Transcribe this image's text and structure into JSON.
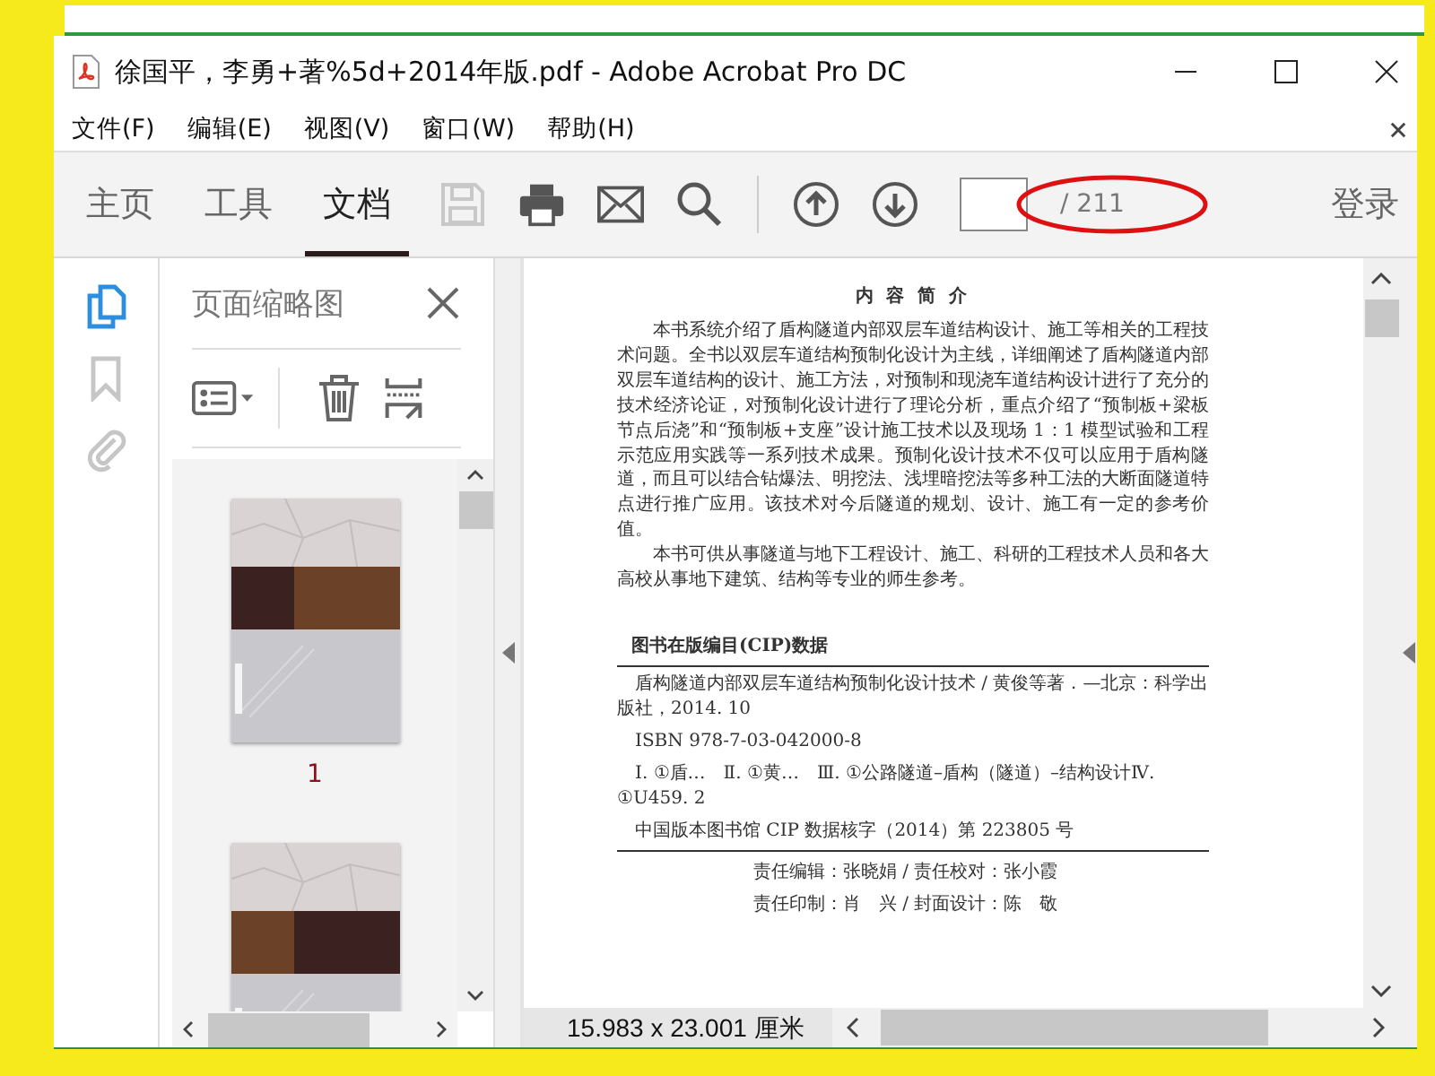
{
  "window": {
    "title": "徐国平，李勇+著%5d+2014年版.pdf - Adobe Acrobat Pro DC"
  },
  "menu": [
    "文件(F)",
    "编辑(E)",
    "视图(V)",
    "窗口(W)",
    "帮助(H)"
  ],
  "tabs": [
    {
      "label": "主页",
      "selected": false
    },
    {
      "label": "工具",
      "selected": false
    },
    {
      "label": "文档",
      "selected": true
    }
  ],
  "toolbar": {
    "save_disabled": true,
    "page_total": "/ 211",
    "annotated": true,
    "login": "登录"
  },
  "rail": [
    {
      "kind": "pages",
      "selected": true
    },
    {
      "kind": "bookmarks",
      "selected": false
    },
    {
      "kind": "attachments",
      "selected": false
    }
  ],
  "thumbnails": {
    "title": "页面缩略图",
    "pages": [
      {
        "label": "1",
        "kind": "picture"
      },
      {
        "kind": "picture"
      }
    ]
  },
  "document": {
    "heading": "内 容 简 介",
    "paragraphs": [
      "本书系统介绍了盾构隧道内部双层车道结构设计、施工等相关的工程技术问题。全书以双层车道结构预制化设计为主线，详细阐述了盾构隧道内部双层车道结构的设计、施工方法，对预制和现浇车道结构设计进行了充分的技术经济论证，对预制化设计进行了理论分析，重点介绍了“预制板+梁板节点后浇”和“预制板+支座”设计施工技术以及现场 1：1 模型试验和工程示范应用实践等一系列技术成果。预制化设计技术不仅可以应用于盾构隧道，而且可以结合钻爆法、明挖法、浅埋暗挖法等多种工法的大断面隧道特点进行推广应用。该技术对今后隧道的规划、设计、施工有一定的参考价值。",
      "本书可供从事隧道与地下工程设计、施工、科研的工程技术人员和各大高校从事地下建筑、结构等专业的师生参考。"
    ],
    "cip_title": "图书在版编目(CIP)数据",
    "cip_lines": [
      "盾构隧道内部双层车道结构预制化设计技术 / 黄俊等著．—北京：科学出版社，2014. 10",
      "ISBN 978-7-03-042000-8",
      "Ⅰ. ①盾…　Ⅱ. ①黄…　Ⅲ. ①公路隧道–盾构（隧道）–结构设计Ⅳ. ①U459. 2"
    ],
    "cip_number": "中国版本图书馆 CIP 数据核字（2014）第 223805 号",
    "credits": [
      "责任编辑：张晓娟 / 责任校对：张小霞",
      "责任印制：肖　兴 / 封面设计：陈　敬"
    ]
  },
  "status": {
    "page_size": "15.983 x 23.001 厘米"
  }
}
